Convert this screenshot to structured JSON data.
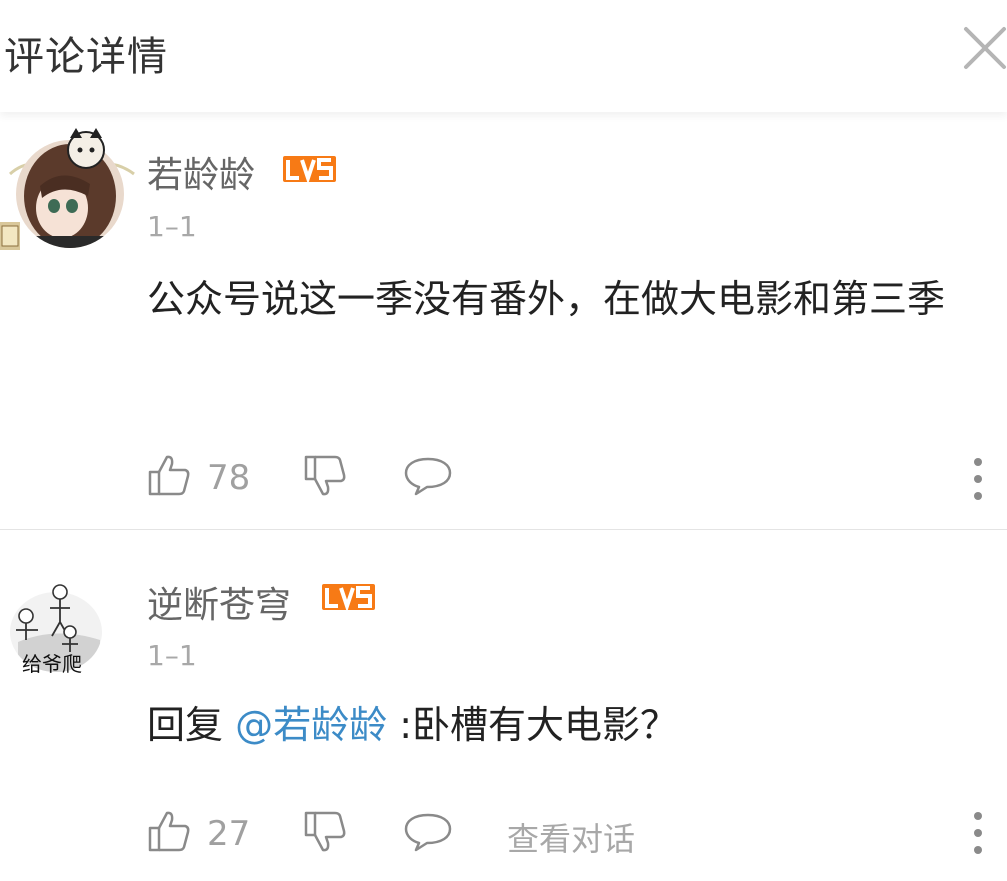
{
  "header": {
    "title": "评论详情",
    "close_icon": "close-icon"
  },
  "colors": {
    "level_badge": "#f77a15",
    "mention": "#3c8bc7",
    "muted": "#a8a8a8"
  },
  "comments": [
    {
      "username": "若龄龄",
      "level_badge": "LV5",
      "date": "1–1",
      "content": "公众号说这一季没有番外，在做大电影和第三季",
      "like_count": "78"
    },
    {
      "username": "逆断苍穹",
      "level_badge": "LV5",
      "date": "1–1",
      "reply_prefix": "回复",
      "mention": "@若龄龄",
      "content": ":卧槽有大电影？",
      "like_count": "27",
      "view_conversation": "查看对话",
      "avatar_caption": "给爷爬"
    }
  ]
}
